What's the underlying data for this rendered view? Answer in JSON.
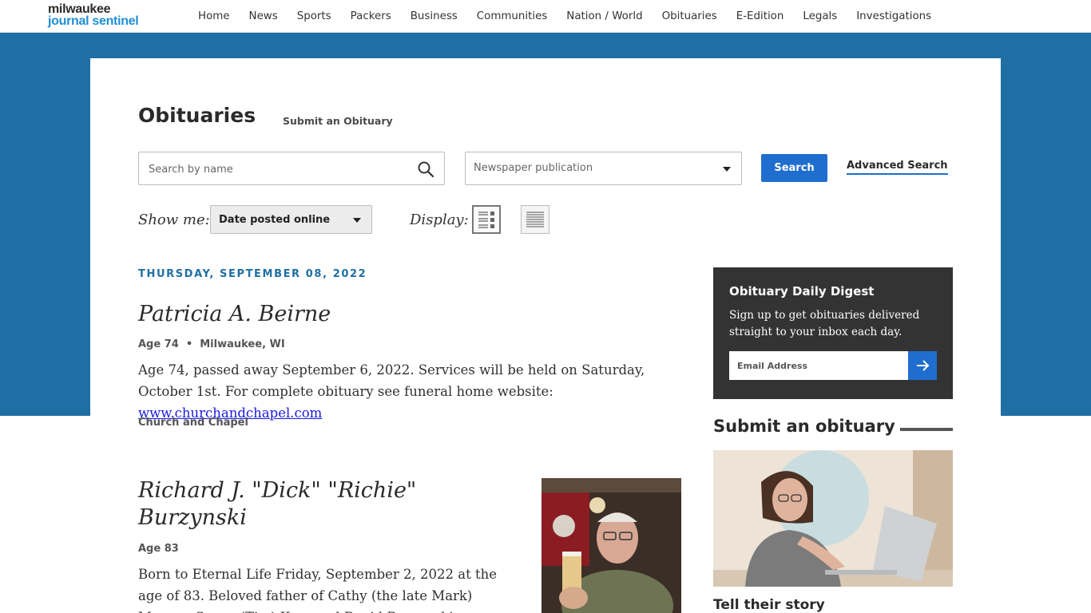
{
  "logo": {
    "line1": "milwaukee",
    "line2": "journal sentinel"
  },
  "nav": [
    "Home",
    "News",
    "Sports",
    "Packers",
    "Business",
    "Communities",
    "Nation / World",
    "Obituaries",
    "E-Edition",
    "Legals",
    "Investigations"
  ],
  "page": {
    "title": "Obituaries",
    "submit_link": "Submit an Obituary"
  },
  "search": {
    "placeholder": "Search by name",
    "publication_placeholder": "Newspaper publication",
    "button": "Search",
    "advanced": "Advanced Search"
  },
  "filters": {
    "show_me_label": "Show me:",
    "show_me_value": "Date posted online",
    "display_label": "Display:"
  },
  "date_header": "THURSDAY, SEPTEMBER 08, 2022",
  "obits": [
    {
      "name": "Patricia A. Beirne",
      "age": "Age 74",
      "location": "Milwaukee, WI",
      "body_text": "Age 74, passed away September 6, 2022. Services will be held on Saturday, October 1st. For complete obituary see funeral home website: ",
      "body_link": "www.churchandchapel.com",
      "funeral_home": "Church and Chapel"
    },
    {
      "name_line1": "Richard J. \"Dick\" \"Richie\"",
      "name_line2": "Burzynski",
      "age": "Age 83",
      "body_line1": "Born to Eternal Life Friday, September 2, 2022 at the",
      "body_line2": "age of 83. Beloved father of Cathy (the late Mark)",
      "body_line3": "Maurer, Susan (Tim) Koss and David Burzynski."
    }
  ],
  "digest": {
    "title": "Obituary Daily Digest",
    "description": "Sign up to get obituaries delivered straight to your inbox each day.",
    "email_placeholder": "Email Address"
  },
  "promo": {
    "heading": "Submit an obituary",
    "caption": "Tell their story"
  },
  "colors": {
    "band": "#1f6fa5",
    "accent": "#1f6ecf",
    "digest_bg": "#333333"
  }
}
